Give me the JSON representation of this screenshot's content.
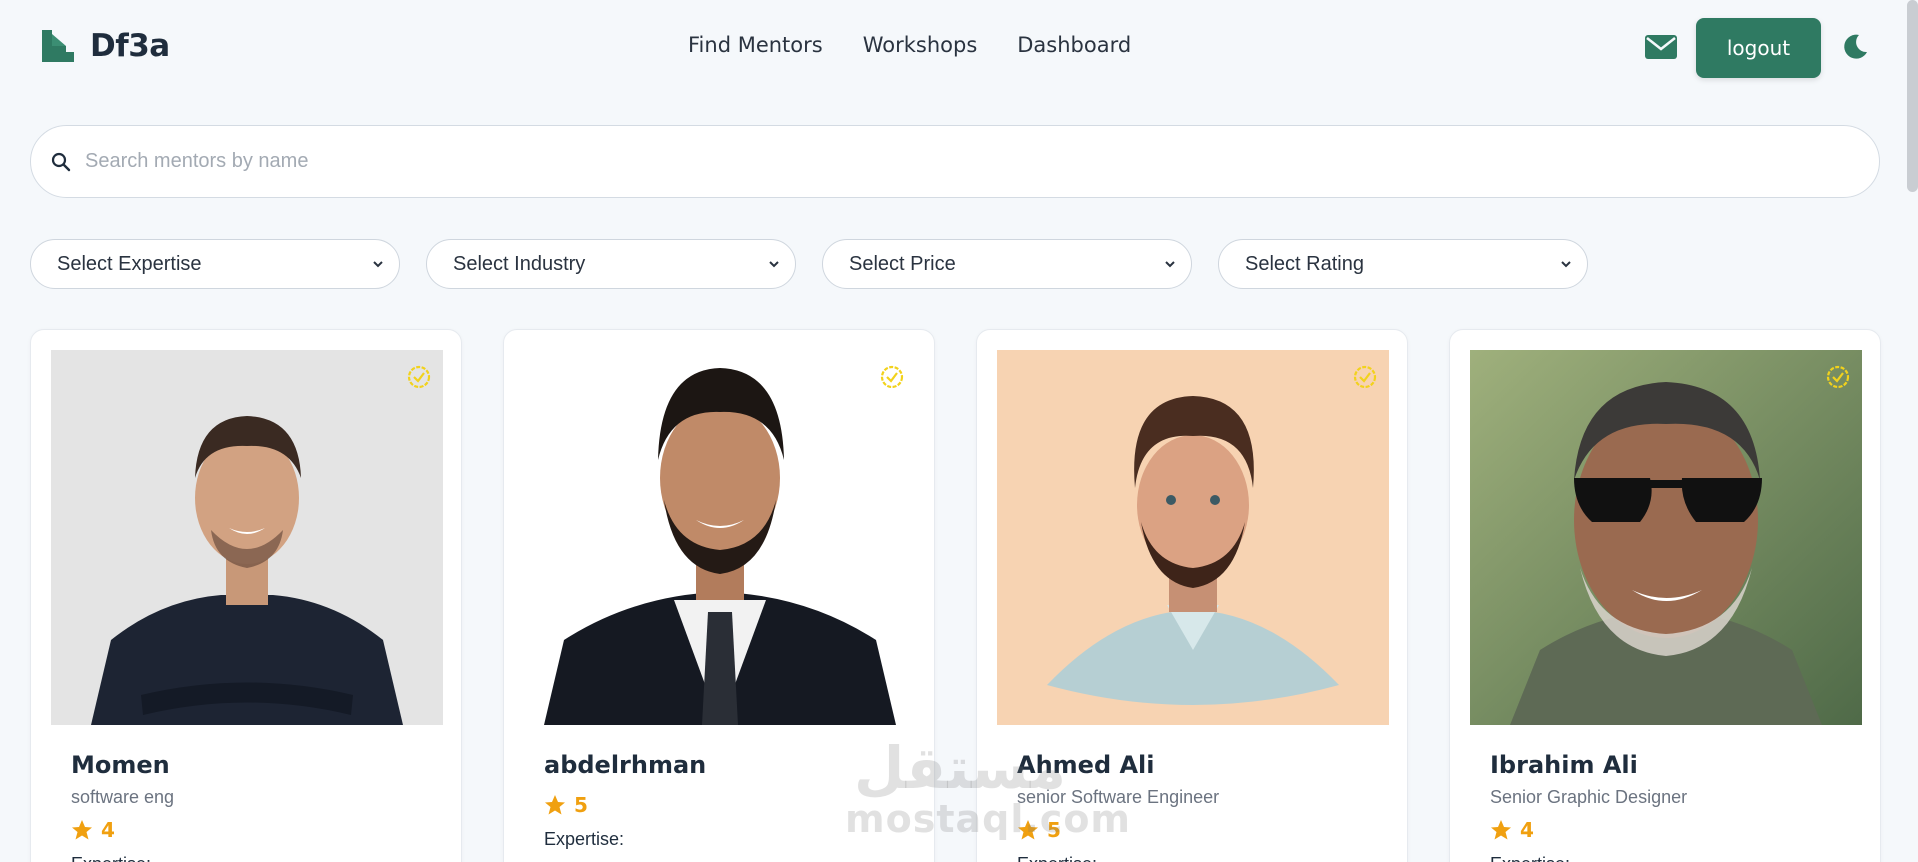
{
  "brand": {
    "name": "Df3a",
    "logo_icon": "df3a-logo-icon",
    "color": "#2f7a62"
  },
  "nav": {
    "links": [
      "Find Mentors",
      "Workshops",
      "Dashboard"
    ],
    "mail_icon": "envelope-icon",
    "logout_label": "logout",
    "theme_icon": "moon-icon"
  },
  "search": {
    "placeholder": "Search mentors by name",
    "value": "",
    "icon": "search-icon"
  },
  "filters": [
    {
      "label": "Select Expertise"
    },
    {
      "label": "Select Industry"
    },
    {
      "label": "Select Price"
    },
    {
      "label": "Select Rating"
    }
  ],
  "mentors": [
    {
      "name": "Momen",
      "title": "software eng",
      "rating": "4",
      "expertise_label": "Expertise:",
      "photo": "photo-man-dark-shirt-arms-crossed",
      "verified": true
    },
    {
      "name": "abdelrhman",
      "title": "",
      "rating": "5",
      "expertise_label": "Expertise:",
      "photo": "photo-man-suit-beard",
      "verified": true
    },
    {
      "name": "Ahmed Ali",
      "title": "senior Software Engineer",
      "rating": "5",
      "expertise_label": "Expertise:",
      "photo": "illustration-man-beard-light-shirt",
      "verified": true
    },
    {
      "name": "Ibrahim Ali",
      "title": "Senior Graphic Designer",
      "rating": "4",
      "expertise_label": "Expertise:",
      "photo": "photo-man-sunglasses-outdoors",
      "verified": true
    }
  ],
  "colors": {
    "accent": "#2f7a62",
    "star": "#f0a010",
    "verified_badge": "#f2d21c",
    "background": "#f5f8fb"
  },
  "watermark": {
    "arabic": "مستقل",
    "latin": "mostaql.com"
  }
}
